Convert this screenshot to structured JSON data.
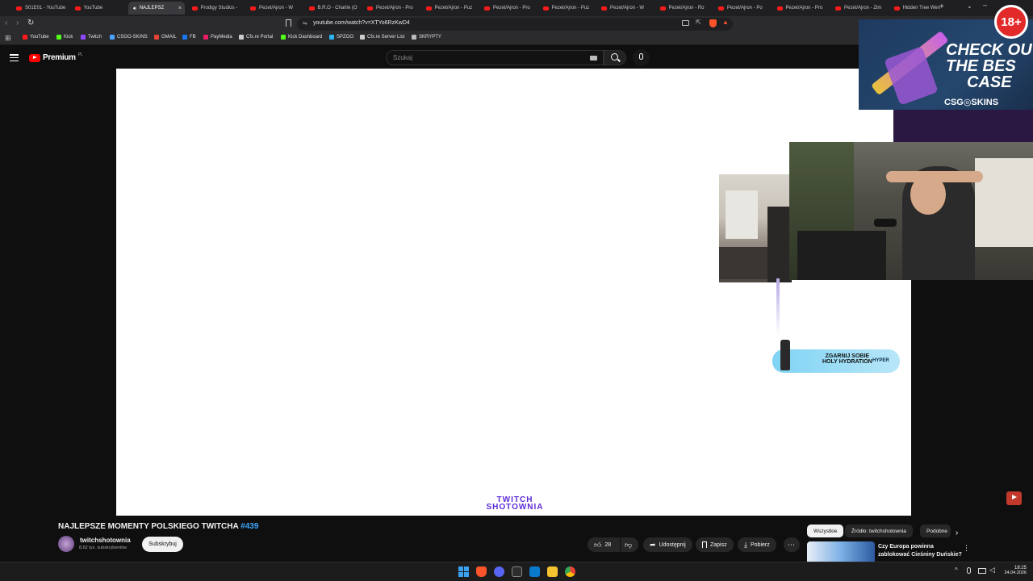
{
  "browser": {
    "tabs": [
      {
        "label": "S01E01 - YouTube"
      },
      {
        "label": "YouTube"
      },
      {
        "label": "NAJLEPSZ",
        "active": true
      },
      {
        "label": "Prodigy Studios -"
      },
      {
        "label": "Pezet/Ajron - W"
      },
      {
        "label": "B.R.O - Charlie (O"
      },
      {
        "label": "Pezet/Ajron - Pro"
      },
      {
        "label": "Pezet/Ajron - Puz"
      },
      {
        "label": "Pezet/Ajron - Pro"
      },
      {
        "label": "Pezet/Ajron - Puz"
      },
      {
        "label": "Pezet/Ajron - W"
      },
      {
        "label": "Pezet/Ajron - Ro"
      },
      {
        "label": "Pezet/Ajron - Po"
      },
      {
        "label": "Pezet/Ajron - Pro"
      },
      {
        "label": "Pezet/Ajron - Zim"
      },
      {
        "label": "Hidden Tree Wen"
      }
    ],
    "new_tab": "+",
    "url": "youtube.com/watch?v=XTYo6RzKwD4",
    "bookmarks": [
      {
        "label": "YouTube",
        "color": "#ff1a1a"
      },
      {
        "label": "Kick",
        "color": "#53fc18"
      },
      {
        "label": "Twitch",
        "color": "#9146ff"
      },
      {
        "label": "CSGO-SKINS",
        "color": "#4aa3ff"
      },
      {
        "label": "GMAIL",
        "color": "#ea4335"
      },
      {
        "label": "FB",
        "color": "#1877f2"
      },
      {
        "label": "PayMedia",
        "color": "#e91e63"
      },
      {
        "label": "Cfx.re Portal",
        "color": "#cccccc"
      },
      {
        "label": "Kick Dashboard",
        "color": "#53fc18"
      },
      {
        "label": "SPZOO",
        "color": "#29b6f6"
      },
      {
        "label": "Cfx.re Server List",
        "color": "#cccccc"
      },
      {
        "label": "SKRYPTY",
        "color": "#bbbbbb"
      }
    ]
  },
  "youtube": {
    "logo_text": "Premium",
    "logo_suffix": "PL",
    "search_placeholder": "Szukaj",
    "video_title": "NAJLEPSZE MOMENTY POLSKIEGO TWITCHA",
    "hashtag": "#439",
    "channel_name": "twitchshotownia",
    "subscribers": "8,62 tys. subskrybentów",
    "subscribe_label": "Subskrybuj",
    "likes": "28",
    "share_label": "Udostępnij",
    "save_label": "Zapisz",
    "download_label": "Pobierz",
    "more_label": "⋯",
    "chips": [
      "Wszystkie",
      "Źródło: twitchshotownia",
      "Podobne"
    ],
    "next_video_title_line1": "Czy Europa powinna",
    "next_video_title_line2": "zablokować Cieśniny Duńskie?"
  },
  "overlays": {
    "ad_line1": "CHECK OU",
    "ad_line2": "THE BES",
    "ad_line3": "CASE",
    "ad_brand": "CSG◎SKINS",
    "age_badge": "18+",
    "hydration_line1": "ZGARNIJ SOBIE",
    "hydration_line2": "HOLY HYDRATION",
    "hydration_brand": "HYPER",
    "watermark_line1": "TWITCH",
    "watermark_line2": "SHOTOWNIA"
  },
  "taskbar": {
    "time": "18:25",
    "date": "24.04.2026"
  },
  "colors": {
    "yt_red": "#ff0000",
    "accent_blue": "#3ea6ff",
    "watermark_purple": "#5b2bd6"
  }
}
